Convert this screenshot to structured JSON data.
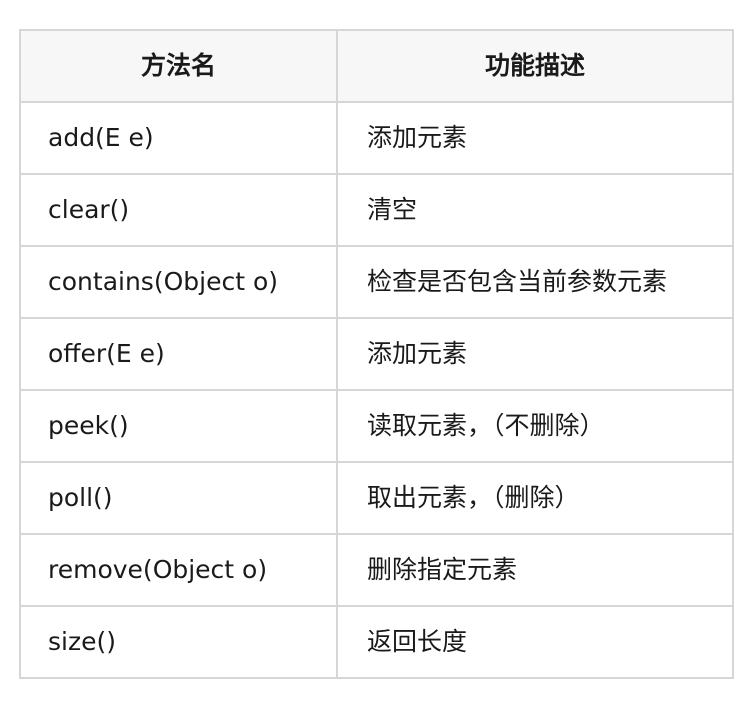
{
  "table": {
    "headers": {
      "method": "方法名",
      "description": "功能描述"
    },
    "rows": [
      {
        "method": "add(E e)",
        "description": "添加元素"
      },
      {
        "method": "clear()",
        "description": "清空"
      },
      {
        "method": "contains(Object o)",
        "description": "检查是否包含当前参数元素"
      },
      {
        "method": "offer(E e)",
        "description": "添加元素"
      },
      {
        "method": "peek()",
        "description": "读取元素，（不删除）"
      },
      {
        "method": "poll()",
        "description": "取出元素，（删除）"
      },
      {
        "method": "remove(Object o)",
        "description": "删除指定元素"
      },
      {
        "method": "size()",
        "description": "返回长度"
      }
    ]
  }
}
